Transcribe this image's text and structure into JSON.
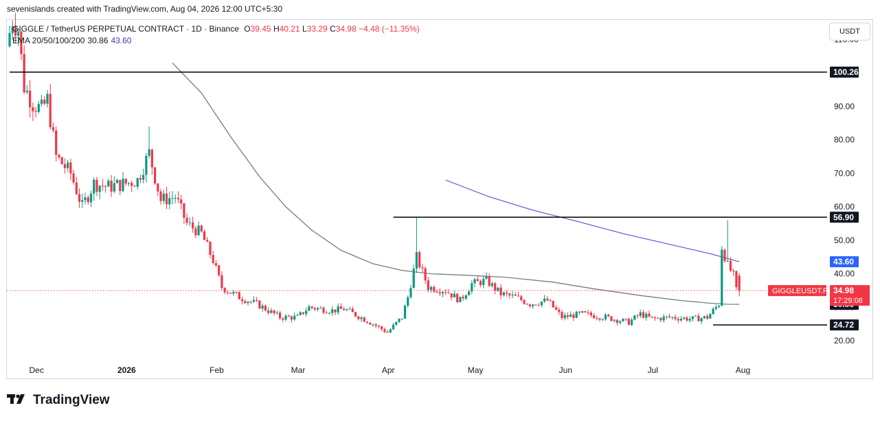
{
  "header": {
    "attribution": "sevenislands created with TradingView.com, Aug 04, 2026 12:00 UTC+5:30"
  },
  "legend": {
    "symbol_line": "GIGGLE / TetherUS PERPETUAL CONTRACT · 1D · Binance",
    "o_key": "O",
    "o_val": "39.45",
    "h_key": "H",
    "h_val": "40.21",
    "l_key": "L",
    "l_val": "33.29",
    "c_key": "C",
    "c_val": "34.98",
    "change": "−4.48 (−11.35%)",
    "ema_label": "EMA 20/50/100/200",
    "ema_value_1": "30.86",
    "ema_value_2": "43.60"
  },
  "currency_button": "USDT",
  "footer": {
    "brand": "TradingView"
  },
  "colors": {
    "up": "#089981",
    "down": "#f23645",
    "ema_200": "#7a7a7a",
    "ema_100": "#6c5fd8",
    "level_line": "#000000",
    "price_label_bg": "#f23645"
  },
  "chart_data": {
    "type": "candlestick",
    "title": "GIGGLE / TetherUS PERPETUAL CONTRACT · 1D · Binance",
    "timeframe": "1D",
    "y_axis": {
      "unit": "USDT",
      "ticks": [
        110,
        100,
        90,
        80,
        70,
        60,
        50,
        40,
        30,
        20
      ],
      "tick_labels": [
        "110.00",
        "100.00",
        "90.00",
        "80.00",
        "70.00",
        "60.00",
        "50.00",
        "40.00",
        "30.00",
        "20.00"
      ],
      "range": [
        15.5,
        117.5
      ]
    },
    "x_axis": {
      "range": [
        "2025-11-26",
        "2026-08-12"
      ],
      "labels": [
        {
          "text": "Dec",
          "date": "2025-12-01",
          "bold": false
        },
        {
          "text": "2026",
          "date": "2026-01-01",
          "bold": true
        },
        {
          "text": "Feb",
          "date": "2026-02-01",
          "bold": false
        },
        {
          "text": "Mar",
          "date": "2026-03-01",
          "bold": false
        },
        {
          "text": "Apr",
          "date": "2026-04-01",
          "bold": false
        },
        {
          "text": "May",
          "date": "2026-05-01",
          "bold": false
        },
        {
          "text": "Jun",
          "date": "2026-06-01",
          "bold": false
        },
        {
          "text": "Jul",
          "date": "2026-07-01",
          "bold": false
        },
        {
          "text": "Aug",
          "date": "2026-08-01",
          "bold": false
        }
      ]
    },
    "anchors": [
      [
        "2025-11-26",
        108
      ],
      [
        "2025-11-28",
        116
      ],
      [
        "2025-11-30",
        113
      ],
      [
        "2025-12-02",
        96
      ],
      [
        "2025-12-05",
        91
      ],
      [
        "2025-12-08",
        89
      ],
      [
        "2025-12-10",
        92
      ],
      [
        "2025-12-13",
        75
      ],
      [
        "2025-12-18",
        70
      ],
      [
        "2025-12-22",
        60
      ],
      [
        "2025-12-26",
        67
      ],
      [
        "2025-12-31",
        66
      ],
      [
        "2026-01-06",
        67
      ],
      [
        "2026-01-10",
        68
      ],
      [
        "2026-01-14",
        76
      ],
      [
        "2026-01-18",
        62
      ],
      [
        "2026-01-23",
        63
      ],
      [
        "2026-01-27",
        55
      ],
      [
        "2026-02-01",
        52
      ],
      [
        "2026-02-05",
        44
      ],
      [
        "2026-02-08",
        36
      ],
      [
        "2026-02-14",
        33
      ],
      [
        "2026-02-20",
        31
      ],
      [
        "2026-02-28",
        27
      ],
      [
        "2026-03-06",
        27
      ],
      [
        "2026-03-10",
        30
      ],
      [
        "2026-03-18",
        29
      ],
      [
        "2026-03-22",
        29.5
      ],
      [
        "2026-03-30",
        26
      ],
      [
        "2026-04-06",
        22.5
      ],
      [
        "2026-04-11",
        27
      ],
      [
        "2026-04-13",
        33
      ],
      [
        "2026-04-16",
        45
      ],
      [
        "2026-04-20",
        36
      ],
      [
        "2026-04-26",
        35
      ],
      [
        "2026-05-01",
        32
      ],
      [
        "2026-05-05",
        37
      ],
      [
        "2026-05-10",
        38
      ],
      [
        "2026-05-15",
        34
      ],
      [
        "2026-05-20",
        33
      ],
      [
        "2026-05-25",
        31
      ],
      [
        "2026-05-31",
        32
      ],
      [
        "2026-06-05",
        27
      ],
      [
        "2026-06-12",
        28
      ],
      [
        "2026-06-20",
        27
      ],
      [
        "2026-06-28",
        25.5
      ],
      [
        "2026-07-02",
        28
      ],
      [
        "2026-07-06",
        26.5
      ],
      [
        "2026-07-12",
        27
      ],
      [
        "2026-07-20",
        26.5
      ],
      [
        "2026-07-25",
        27
      ],
      [
        "2026-07-29",
        31
      ],
      [
        "2026-07-30",
        48
      ],
      [
        "2026-08-01",
        42.5
      ],
      [
        "2026-08-03",
        39.45
      ],
      [
        "2026-08-04",
        34.98
      ]
    ],
    "last_candle": {
      "date": "2026-08-04",
      "open": 39.45,
      "high": 40.21,
      "low": 33.29,
      "close": 34.98
    },
    "spikes": [
      {
        "date": "2025-11-28",
        "high": 118
      },
      {
        "date": "2026-01-13",
        "high": 84
      },
      {
        "date": "2026-04-15",
        "high": 57
      },
      {
        "date": "2026-07-31",
        "high": 56
      }
    ],
    "series": [
      {
        "name": "EMA 200",
        "color": "#7a7a7a",
        "points": [
          [
            "2026-01-21",
            103
          ],
          [
            "2026-01-31",
            94
          ],
          [
            "2026-02-10",
            81
          ],
          [
            "2026-02-20",
            69
          ],
          [
            "2026-03-01",
            60
          ],
          [
            "2026-03-10",
            53
          ],
          [
            "2026-03-20",
            47
          ],
          [
            "2026-03-31",
            43
          ],
          [
            "2026-04-10",
            41
          ],
          [
            "2026-04-20",
            40
          ],
          [
            "2026-05-01",
            39.6
          ],
          [
            "2026-05-15",
            39
          ],
          [
            "2026-06-01",
            37.5
          ],
          [
            "2026-06-15",
            35.5
          ],
          [
            "2026-07-01",
            33.5
          ],
          [
            "2026-07-15",
            32
          ],
          [
            "2026-07-25",
            31.2
          ],
          [
            "2026-07-31",
            30.9
          ],
          [
            "2026-08-04",
            30.86
          ]
        ]
      },
      {
        "name": "EMA 100",
        "color": "#6c5fd8",
        "points": [
          [
            "2026-04-25",
            68
          ],
          [
            "2026-05-10",
            63
          ],
          [
            "2026-05-25",
            59
          ],
          [
            "2026-06-10",
            55.5
          ],
          [
            "2026-06-25",
            52
          ],
          [
            "2026-07-10",
            49
          ],
          [
            "2026-07-25",
            46
          ],
          [
            "2026-08-04",
            43.6
          ]
        ]
      }
    ],
    "horizontal_levels": [
      {
        "value": 100.26,
        "label": "100.26",
        "from": "2025-11-26",
        "to": "2026-08-12"
      },
      {
        "value": 56.9,
        "label": "56.90",
        "from": "2026-04-07",
        "to": "2026-08-12"
      },
      {
        "value": 24.72,
        "label": "24.72",
        "from": "2026-07-26",
        "to": "2026-08-12"
      }
    ],
    "price_labels": [
      {
        "value": 43.6,
        "text": "43.60",
        "style": "ema100"
      },
      {
        "value": 30.86,
        "text": "30.86",
        "style": "dark"
      }
    ],
    "current_price": {
      "value": 34.98,
      "text": "34.98",
      "countdown": "17:29:08",
      "symbol_tag": "GIGGLEUSDT.P"
    }
  }
}
